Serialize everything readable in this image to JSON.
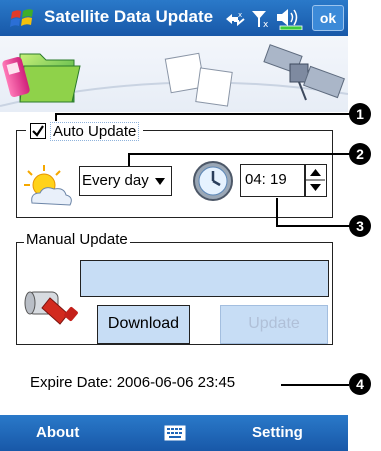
{
  "window": {
    "title": "Satellite Data Update",
    "ok_label": "ok"
  },
  "auto_update": {
    "checkbox_label": "Auto Update",
    "checked": true,
    "frequency": "Every day",
    "time_value": "04:  19"
  },
  "manual_update": {
    "group_label": "Manual Update",
    "status_text": "",
    "download_label": "Download",
    "update_label": "Update"
  },
  "expire": {
    "text": "Expire Date: 2006-06-06 23:45"
  },
  "softkeys": {
    "left": "About",
    "right": "Setting"
  },
  "callouts": [
    "1",
    "2",
    "3",
    "4"
  ],
  "colors": {
    "title_bar": "#1f66b8",
    "button_fill": "#c7ddf5"
  }
}
